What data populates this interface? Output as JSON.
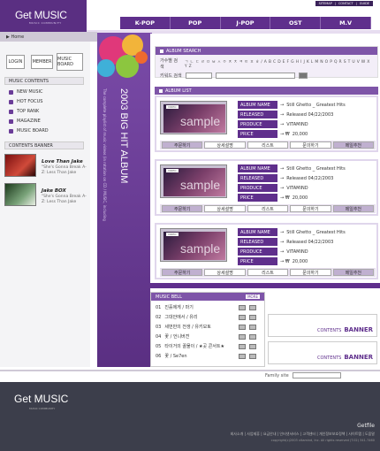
{
  "brand": {
    "name": "Get MUSIC",
    "tagline": "MUSIC COMMUNITY"
  },
  "util_links": [
    "SITEMAP",
    "CONTACT",
    "GUIDE"
  ],
  "nav": [
    "K-POP",
    "POP",
    "J-POP",
    "OST",
    "M.V"
  ],
  "home": "Home",
  "login": {
    "login": "LOGIN",
    "member": "MEMBER",
    "board": "MUSIC BOARD"
  },
  "sidebar": {
    "contents_title": "MUSIC CONTENTS",
    "items": [
      "NEW MUSIC",
      "HOT FOCUS",
      "TOP RANK",
      "MAGAZINE",
      "MUSIC BOARD"
    ],
    "banner_title": "CONTENTS BANNER",
    "banners": [
      {
        "title": "Love Than Jake",
        "desc": "\"She's Gonna Break A-Z: Less Than Jake"
      },
      {
        "title": "Jake BOX",
        "desc": "\"She's Gonna Break A-Z: Less Than Jake"
      }
    ]
  },
  "vertical": {
    "title": "2003 BIG HIT ALBUM",
    "sub": "The complete playlist of music videos (in rotation on CD / MUSIC, including"
  },
  "album_search": {
    "title": "ALBUM SEARCH",
    "row1_label": "가수별 검색",
    "row1_alpha": "ㄱ ㄴ ㄷ ㄹ ㅁ ㅂ ㅅ ㅇ ㅈ ㅊ ㅋ ㅌ ㅍ ㅎ / A B C D E F G H I J K L M N O P Q R S T U V W X Y Z",
    "row2_label": "키워드 검색"
  },
  "album_list": {
    "title": "ALBUM LIST",
    "thumb_word": "sample",
    "thumb_tag": "VIDEO",
    "labels": [
      "ALBUM NAME",
      "RELEASED",
      "PRODUCE",
      "PRICE"
    ],
    "actions": [
      "주문하기",
      "상세설명",
      "리스트",
      "문의하기",
      "메일추천"
    ],
    "items": [
      {
        "album": "Still Ghetto _ Greatest Hits",
        "released": "Released 04/22/2003",
        "produce": "VITAMIND",
        "price": "20,000"
      },
      {
        "album": "Still Ghetto _ Greatest Hits",
        "released": "Released 04/22/2003",
        "produce": "VITAMIND",
        "price": "20,000"
      },
      {
        "album": "Still Ghetto _ Greatest Hits",
        "released": "Released 04/22/2003",
        "produce": "VITAMIND",
        "price": "20,000"
      }
    ]
  },
  "music_bell": {
    "title": "MUSIC BELL",
    "more": "MORE",
    "items": [
      {
        "no": "01",
        "title": "진흙에게 / 마기"
      },
      {
        "no": "02",
        "title": "그대안에서 / 유리"
      },
      {
        "no": "03",
        "title": "세번만의 전생 / 유키모토"
      },
      {
        "no": "04",
        "title": "꽃 / 언니버젼"
      },
      {
        "no": "05",
        "title": "타이거의 꿀물이 / ★곳 콘서트★"
      },
      {
        "no": "06",
        "title": "꽃 / Se7en"
      }
    ]
  },
  "contents_banner": {
    "label": "CONTENTS",
    "bold": "BANNER"
  },
  "family_site": "Family site",
  "footer": {
    "links": "회사소개 | 사업제휴 | 요금안내 | 인터넷서비스 | 고객센터 | 개인정보보호정책 | 사이트맵 | 도움말",
    "copy": "copyright(c)2003 vitamind, Inc. All rights reserved (T.02) 341-7460",
    "gf": "Getfile"
  },
  "colors": {
    "primary": "#5f2f8c",
    "dark_footer": "#3c3e4b"
  }
}
